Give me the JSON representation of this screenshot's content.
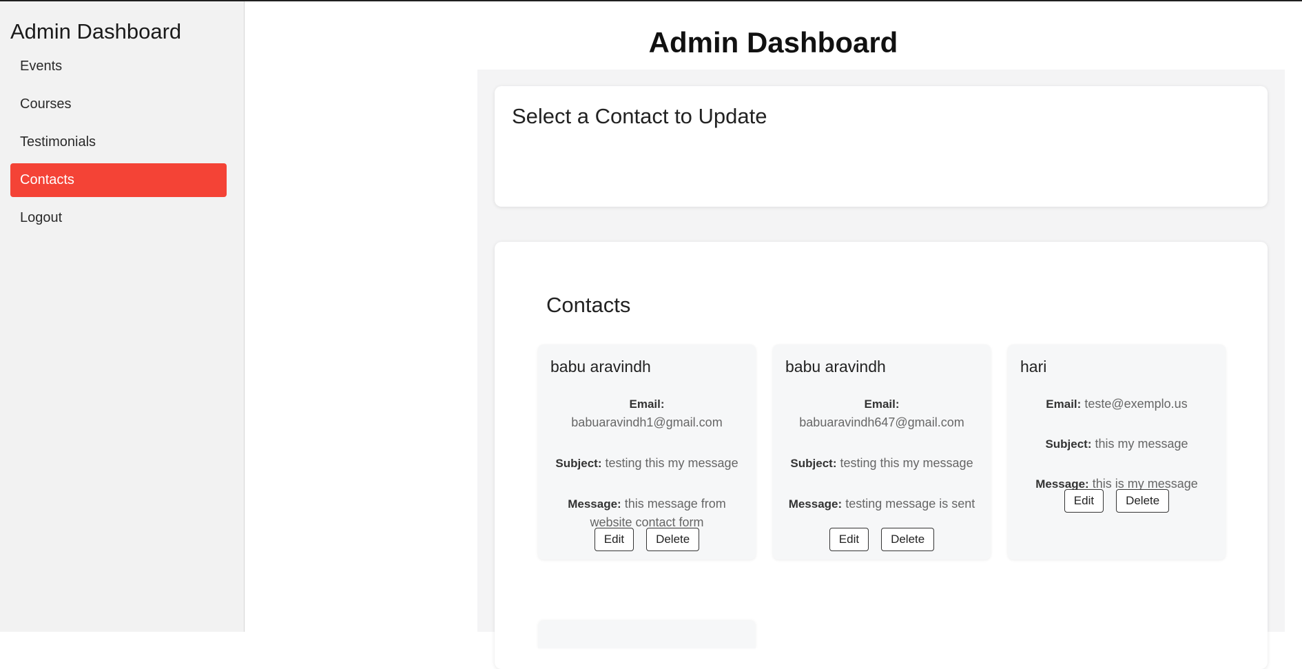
{
  "sidebar": {
    "title": "Admin Dashboard",
    "items": [
      {
        "label": "Events",
        "active": false
      },
      {
        "label": "Courses",
        "active": false
      },
      {
        "label": "Testimonials",
        "active": false
      },
      {
        "label": "Contacts",
        "active": true
      },
      {
        "label": "Logout",
        "active": false
      }
    ]
  },
  "main": {
    "title": "Admin Dashboard",
    "update_panel_title": "Select a Contact to Update",
    "list_title": "Contacts",
    "field_labels": {
      "email": "Email:",
      "subject": "Subject:",
      "message": "Message:"
    },
    "buttons": {
      "edit": "Edit",
      "delete": "Delete"
    },
    "contacts": [
      {
        "name": "babu aravindh",
        "email": "babuaravindh1@gmail.com",
        "subject": "testing this my message",
        "message": "this message from website contact form"
      },
      {
        "name": "babu aravindh",
        "email": "babuaravindh647@gmail.com",
        "subject": "testing this my message",
        "message": "testing message is sent"
      },
      {
        "name": "hari",
        "email": "teste@exemplo.us",
        "subject": "this my message",
        "message": "this is my message"
      }
    ]
  },
  "colors": {
    "accent": "#f44336",
    "sidebar_bg": "#f2f2f2",
    "content_bg": "#f4f4f5"
  }
}
